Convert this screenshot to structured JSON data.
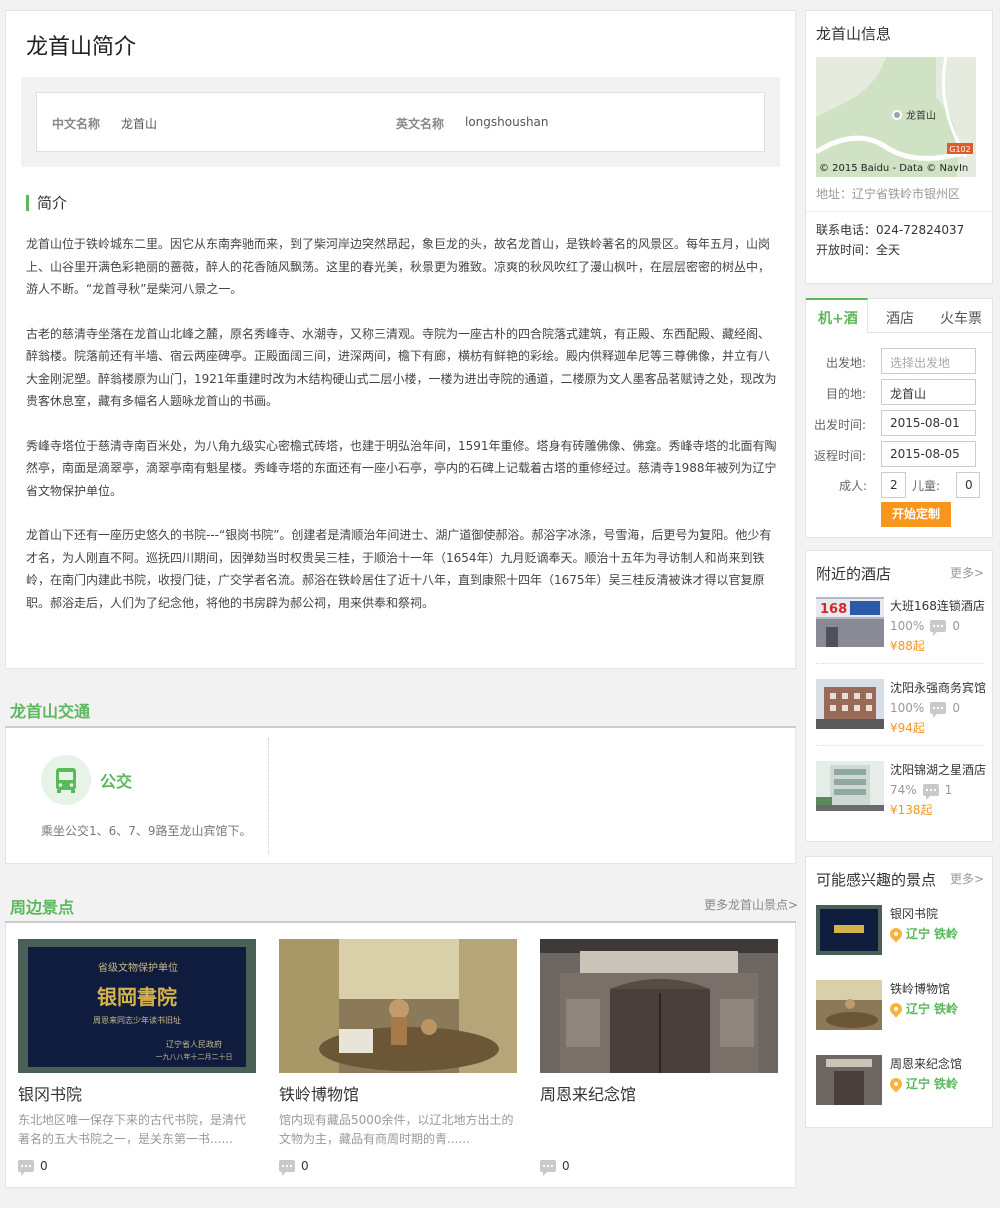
{
  "intro": {
    "title": "龙首山简介",
    "cn_name_label": "中文名称",
    "cn_name": "龙首山",
    "en_name_label": "英文名称",
    "en_name": "longshoushan",
    "section_title": "简介",
    "paragraphs": [
      "龙首山位于铁岭城东二里。因它从东南奔驰而来，到了柴河岸边突然昂起，象巨龙的头，故名龙首山，是铁岭著名的风景区。每年五月，山岗上、山谷里开满色彩艳丽的蔷薇，醉人的花香随风飘荡。这里的春光美，秋景更为雅致。凉爽的秋风吹红了漫山枫叶，在层层密密的树丛中，游人不断。“龙首寻秋”是柴河八景之一。",
      "古老的慈清寺坐落在龙首山北峰之麓，原名秀峰寺、水潮寺，又称三清观。寺院为一座古朴的四合院落式建筑，有正殿、东西配殿、藏经阁、醉翁楼。院落前还有半墙、宿云两座碑亭。正殿面阔三间，进深两间，檐下有廊，横枋有鲜艳的彩绘。殿内供释迦牟尼等三尊佛像，并立有八大金刚泥塑。醉翁楼原为山门，1921年重建时改为木结构硬山式二层小楼，一楼为进出寺院的通道，二楼原为文人墨客品茗赋诗之处，现改为贵客休息室，藏有多幅名人题咏龙首山的书画。",
      "秀峰寺塔位于慈清寺南百米处，为八角九级实心密檐式砖塔，也建于明弘治年间，1591年重修。塔身有砖雕佛像、佛龛。秀峰寺塔的北面有陶然亭，南面是滴翠亭，滴翠亭南有魁星楼。秀峰寺塔的东面还有一座小石亭，亭内的石碑上记载着古塔的重修经过。慈清寺1988年被列为辽宁省文物保护单位。",
      "龙首山下还有一座历史悠久的书院---“银岗书院”。创建者是清顺治年间进士、湖广道御使郝浴。郝浴字冰涤，号雪海，后更号为复阳。他少有才名，为人刚直不阿。巡抚四川期间，因弹劾当时权贵吴三桂，于顺治十一年（1654年）九月贬谪奉天。顺治十五年为寻访制人和尚来到铁岭，在南门内建此书院，收授门徒，广交学者名流。郝浴在铁岭居住了近十八年，直到康熙十四年（1675年）吴三桂反清被诛才得以官复原职。郝浴走后，人们为了纪念他，将他的书房辟为郝公祠，用来供奉和祭祠。"
    ]
  },
  "traffic": {
    "title": "龙首山交通",
    "icon": "bus-icon",
    "mode": "公交",
    "desc": "乘坐公交1、6、7、9路至龙山宾馆下。"
  },
  "nearby": {
    "title": "周边景点",
    "more": "更多龙首山景点>",
    "items": [
      {
        "name": "银冈书院",
        "desc": "东北地区唯一保存下来的古代书院，是清代著名的五大书院之一，是关东第一书......",
        "comments": "0",
        "sign": {
          "top": "省级文物保护单位",
          "main": "银岡書院",
          "sub": "周恩来同志少年读书旧址",
          "foot1": "辽宁省人民政府",
          "foot2": "一九八八年十二月二十日"
        }
      },
      {
        "name": "铁岭博物馆",
        "desc": "馆内现有藏品5000余件，以辽北地方出土的文物为主，藏品有商周时期的青......",
        "comments": "0"
      },
      {
        "name": "周恩来纪念馆",
        "desc": "",
        "comments": "0"
      }
    ]
  },
  "info": {
    "title": "龙首山信息",
    "map_label": "龙首山",
    "map_road": "G102",
    "map_credit": "© 2015 Baidu - Data © NavIn",
    "address": "地址：辽宁省铁岭市银州区",
    "phone": "联系电话：024-72824037",
    "open": "开放时间：全天"
  },
  "booking": {
    "tabs": [
      "机+酒",
      "酒店",
      "火车票"
    ],
    "from_label": "出发地:",
    "from_placeholder": "选择出发地",
    "to_label": "目的地:",
    "to_value": "龙首山",
    "depart_label": "出发时间:",
    "depart_value": "2015-08-01",
    "return_label": "返程时间:",
    "return_value": "2015-08-05",
    "adult_label": "成人:",
    "adult_value": "2",
    "child_label": "儿童:",
    "child_value": "0",
    "submit": "开始定制"
  },
  "hotels": {
    "title": "附近的酒店",
    "more": "更多>",
    "items": [
      {
        "name": "大班168连锁酒店",
        "rate": "100%",
        "comments": "0",
        "price": "¥88起",
        "sign": "168"
      },
      {
        "name": "沈阳永强商务宾馆",
        "rate": "100%",
        "comments": "0",
        "price": "¥94起"
      },
      {
        "name": "沈阳锦湖之星酒店",
        "rate": "74%",
        "comments": "1",
        "price": "¥138起"
      }
    ]
  },
  "interest": {
    "title": "可能感兴趣的景点",
    "more": "更多>",
    "items": [
      {
        "name": "银冈书院",
        "province": "辽宁",
        "city": "铁岭"
      },
      {
        "name": "铁岭博物馆",
        "province": "辽宁",
        "city": "铁岭"
      },
      {
        "name": "周恩来纪念馆",
        "province": "辽宁",
        "city": "铁岭"
      }
    ]
  },
  "colors": {
    "accent_green": "#5cb85c",
    "accent_orange": "#f7951d"
  }
}
